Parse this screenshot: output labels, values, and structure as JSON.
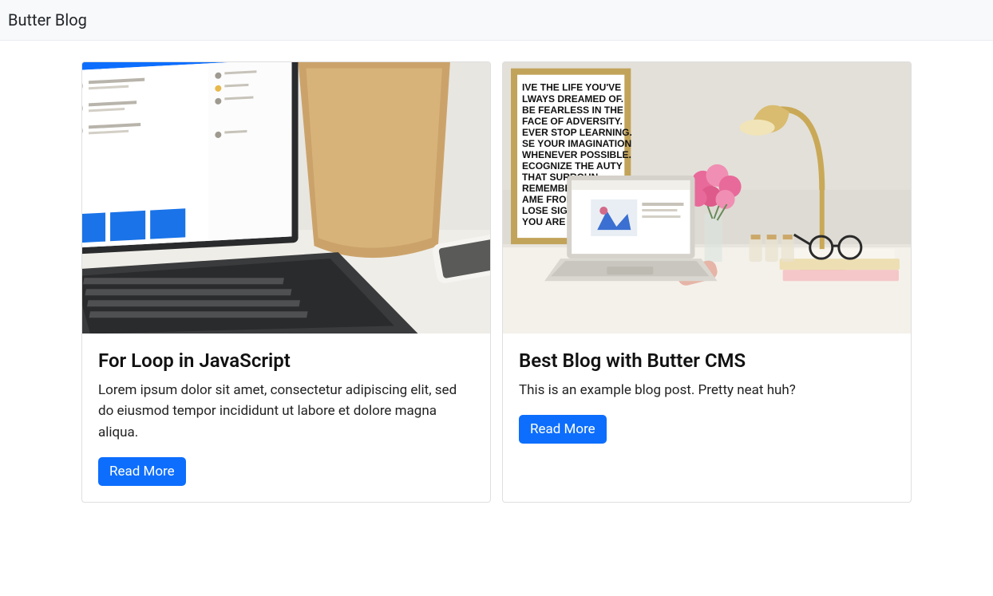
{
  "navbar": {
    "brand": "Butter Blog"
  },
  "posts": [
    {
      "title": "For Loop in JavaScript",
      "summary": "Lorem ipsum dolor sit amet, consectetur adipiscing elit, sed do eiusmod tempor incididunt ut labore et dolore magna aliqua.",
      "button_label": "Read More",
      "image_alt": "Laptop on desk with coffee cup and phone"
    },
    {
      "title": "Best Blog with Butter CMS",
      "summary": "This is an example blog post. Pretty neat huh?",
      "button_label": "Read More",
      "image_alt": "Desk with laptop, lamp, flowers and notebooks"
    }
  ],
  "colors": {
    "primary": "#0d6efd",
    "navbar_bg": "#f8f9fa",
    "text": "#212529"
  }
}
